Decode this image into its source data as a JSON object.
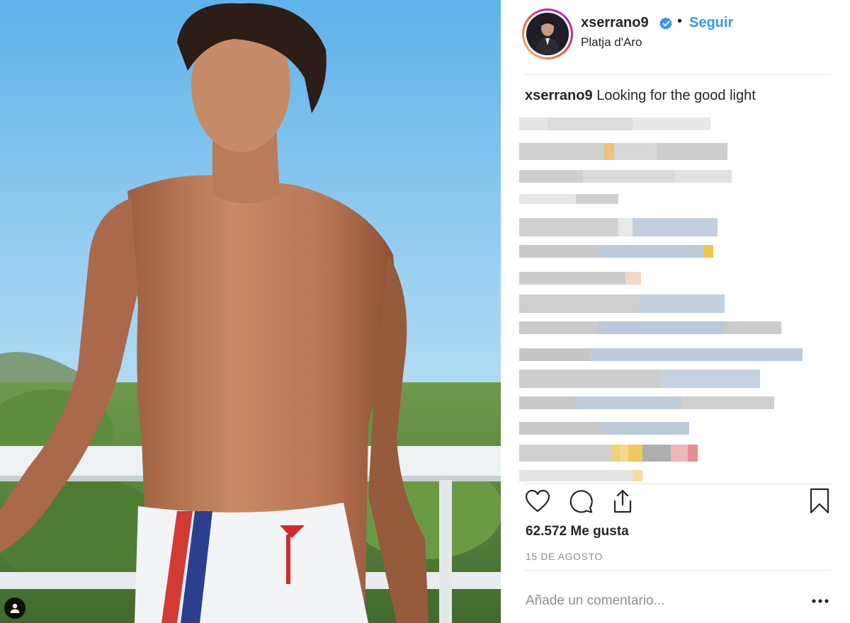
{
  "post": {
    "username": "xserrano9",
    "follow_label": "Seguir",
    "separator": "•",
    "location": "Platja d'Aro",
    "caption_user": "xserrano9",
    "caption_text": "Looking for the good light",
    "likes": "62.572 Me gusta",
    "date": "15 DE AGOSTO",
    "comment_placeholder": "Añade un comentario..."
  },
  "icons": {
    "verified": "verified-badge-icon",
    "like": "heart-icon",
    "comment": "speech-bubble-icon",
    "share": "share-icon",
    "save": "bookmark-icon",
    "more": "more-options-icon",
    "tag": "user-tag-icon"
  },
  "colors": {
    "accent_blue": "#3897f0",
    "text": "#262626",
    "muted": "#8e8e8e",
    "divider": "#e6e6e6",
    "story_ring": "#e95950"
  }
}
